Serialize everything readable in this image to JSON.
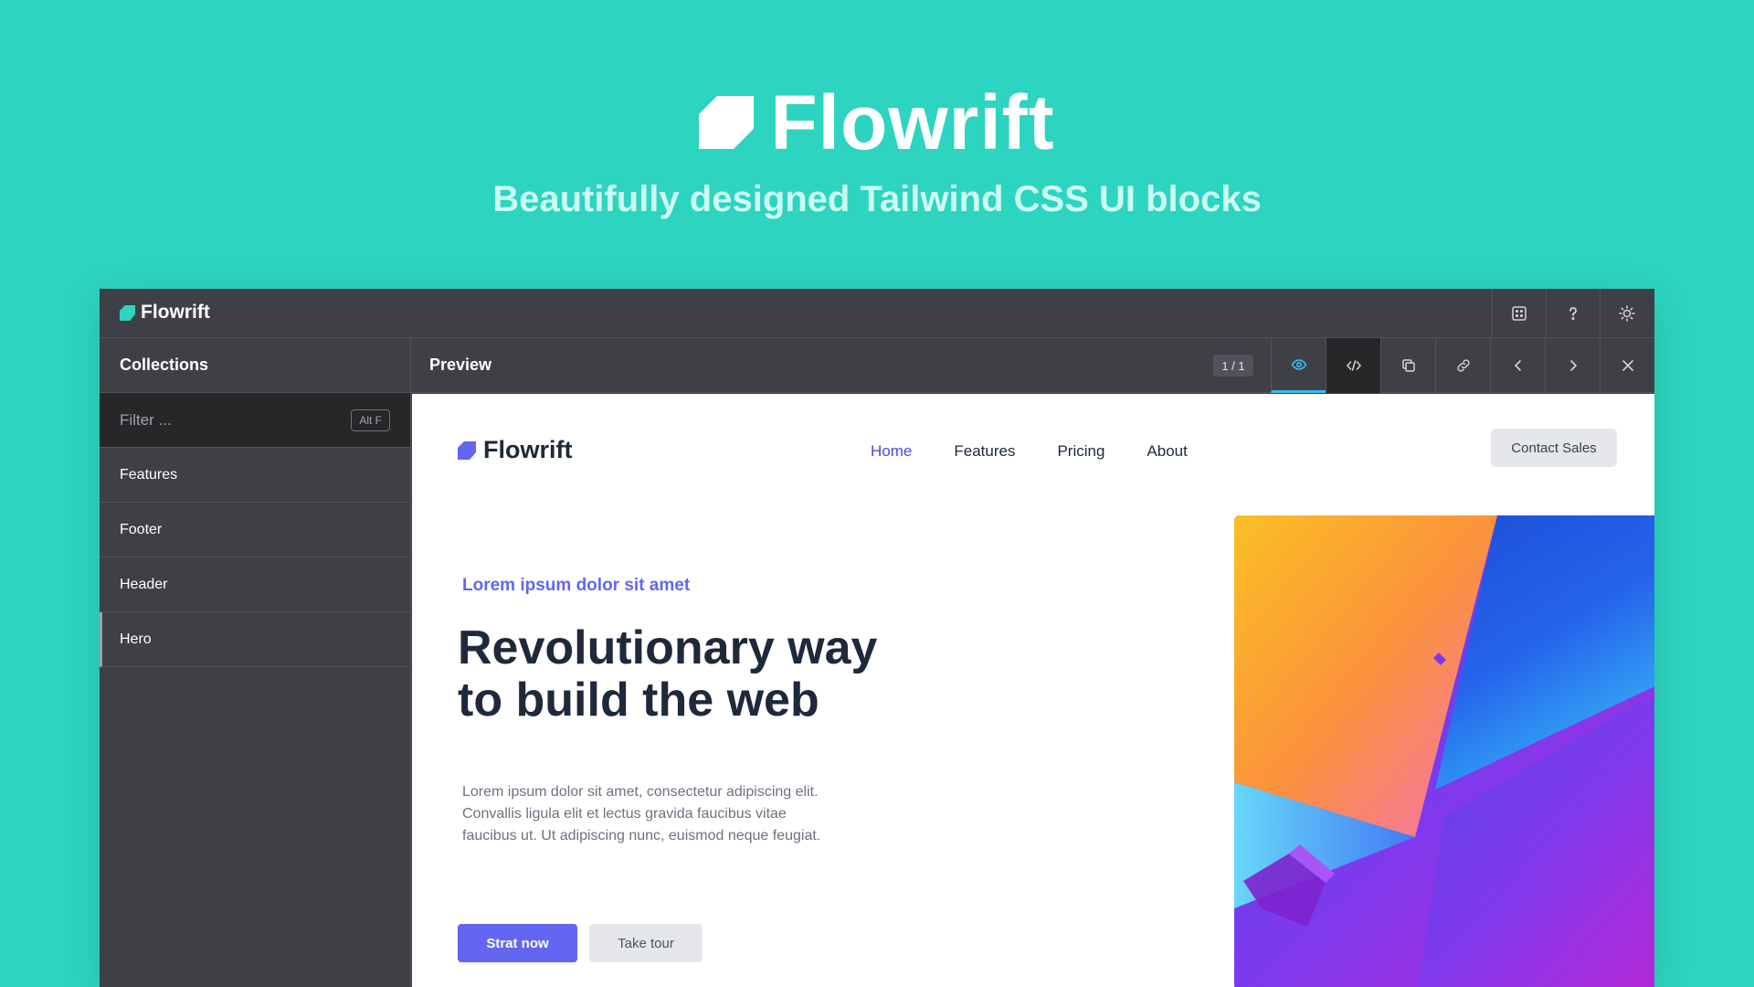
{
  "hero": {
    "brand_name": "Flowrift",
    "tagline": "Beautifully designed Tailwind CSS UI blocks"
  },
  "app": {
    "brand_name": "Flowrift",
    "topbar_icons": [
      "grid-icon",
      "help-icon",
      "sun-icon"
    ],
    "sidebar": {
      "title": "Collections",
      "filter_placeholder": "Filter ...",
      "filter_shortcut": "Alt F",
      "items": [
        {
          "label": "Features",
          "active": false
        },
        {
          "label": "Footer",
          "active": false
        },
        {
          "label": "Header",
          "active": false
        },
        {
          "label": "Hero",
          "active": true
        }
      ]
    },
    "preview": {
      "title": "Preview",
      "page_count": "1 / 1",
      "actions": [
        "eye-icon",
        "code-icon",
        "copy-icon",
        "link-icon",
        "chevron-left-icon",
        "chevron-right-icon",
        "close-icon"
      ],
      "active_action": "eye-icon"
    }
  },
  "site": {
    "logo_text": "Flowrift",
    "nav": [
      {
        "label": "Home",
        "active": true
      },
      {
        "label": "Features",
        "active": false
      },
      {
        "label": "Pricing",
        "active": false
      },
      {
        "label": "About",
        "active": false
      }
    ],
    "contact_label": "Contact Sales",
    "eyebrow": "Lorem ipsum dolor sit amet",
    "headline_line1": "Revolutionary way",
    "headline_line2": "to build the web",
    "body": "Lorem ipsum dolor sit amet, consectetur adipiscing elit. Convallis ligula elit et lectus gravida faucibus vitae faucibus ut. Ut adipiscing nunc, euismod neque feugiat.",
    "primary_cta": "Strat now",
    "secondary_cta": "Take tour"
  },
  "colors": {
    "background": "#2dd4bf",
    "panel": "#3f3f46",
    "accent": "#6366f1",
    "active_tab": "#38bdf8"
  }
}
